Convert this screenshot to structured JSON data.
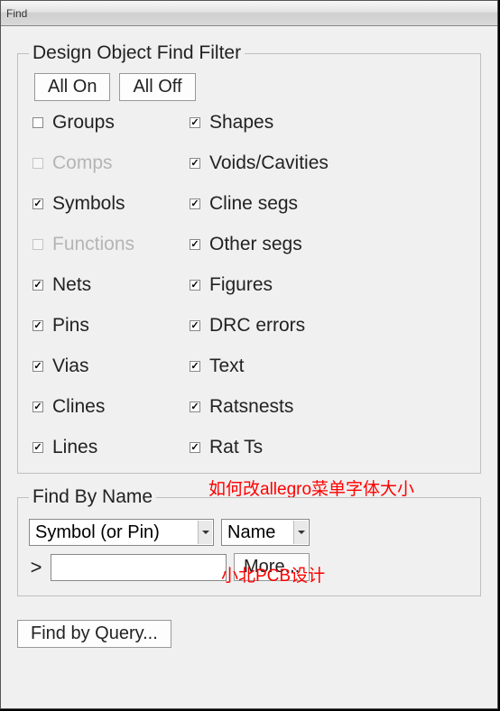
{
  "window": {
    "title": "Find"
  },
  "filter": {
    "legend": "Design Object Find Filter",
    "all_on": "All On",
    "all_off": "All Off",
    "left": [
      {
        "label": "Groups",
        "checked": false,
        "enabled": true
      },
      {
        "label": "Comps",
        "checked": false,
        "enabled": false
      },
      {
        "label": "Symbols",
        "checked": true,
        "enabled": true
      },
      {
        "label": "Functions",
        "checked": false,
        "enabled": false
      },
      {
        "label": "Nets",
        "checked": true,
        "enabled": true
      },
      {
        "label": "Pins",
        "checked": true,
        "enabled": true
      },
      {
        "label": "Vias",
        "checked": true,
        "enabled": true
      },
      {
        "label": "Clines",
        "checked": true,
        "enabled": true
      },
      {
        "label": "Lines",
        "checked": true,
        "enabled": true
      }
    ],
    "right": [
      {
        "label": "Shapes",
        "checked": true,
        "enabled": true
      },
      {
        "label": "Voids/Cavities",
        "checked": true,
        "enabled": true
      },
      {
        "label": "Cline segs",
        "checked": true,
        "enabled": true
      },
      {
        "label": "Other segs",
        "checked": true,
        "enabled": true
      },
      {
        "label": "Figures",
        "checked": true,
        "enabled": true
      },
      {
        "label": "DRC errors",
        "checked": true,
        "enabled": true
      },
      {
        "label": "Text",
        "checked": true,
        "enabled": true
      },
      {
        "label": "Ratsnests",
        "checked": true,
        "enabled": true
      },
      {
        "label": "Rat Ts",
        "checked": true,
        "enabled": true
      }
    ]
  },
  "findByName": {
    "legend": "Find By Name",
    "type_select": "Symbol (or Pin)",
    "name_select": "Name",
    "gt": ">",
    "input_value": "",
    "more": "More..."
  },
  "query": {
    "label": "Find by Query..."
  },
  "overlays": {
    "line1": "如何改allegro菜单字体大小",
    "line2": "小北PCB设计"
  }
}
